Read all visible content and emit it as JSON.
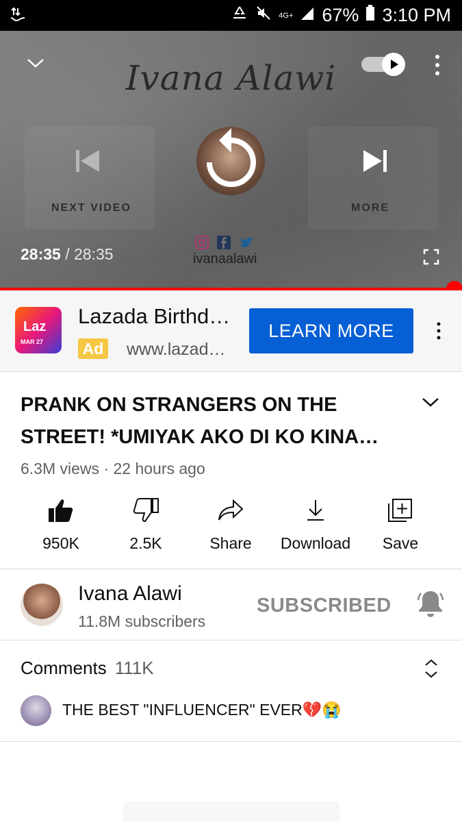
{
  "status_bar": {
    "network_label": "4G+",
    "battery": "67%",
    "time": "3:10 PM"
  },
  "player": {
    "channel_logo_text": "Ivana Alawi",
    "prev_label": "NEXT VIDEO",
    "next_label": "MORE",
    "current_time": "28:35",
    "separator": " / ",
    "duration": "28:35",
    "social_handle": "ivanaalawi",
    "progress_fraction": 1.0,
    "autoplay_on": true
  },
  "ad": {
    "title": "Lazada Birthd…",
    "badge": "Ad",
    "url": "www.lazad…",
    "cta": "LEARN MORE",
    "logo_text": "Laz",
    "logo_sub": "MAR 27"
  },
  "video": {
    "title": "PRANK ON STRANGERS ON THE STREET! *UMIYAK AKO DI KO KINA…",
    "meta": "6.3M views · 22 hours ago"
  },
  "actions": [
    {
      "label": "950K",
      "icon": "thumbs-up-filled"
    },
    {
      "label": "2.5K",
      "icon": "thumbs-down-outline"
    },
    {
      "label": "Share",
      "icon": "share-arrow"
    },
    {
      "label": "Download",
      "icon": "download-arrow"
    },
    {
      "label": "Save",
      "icon": "add-to-playlist"
    }
  ],
  "channel": {
    "name": "Ivana Alawi",
    "subscribers": "11.8M subscribers",
    "subscribe_state": "SUBSCRIBED"
  },
  "comments": {
    "label": "Comments",
    "count": "111K",
    "top_comment": "THE BEST \"INFLUENCER\" EVER💔😭"
  },
  "colors": {
    "accent_red": "#ff0000",
    "cta_blue": "#065fd4",
    "ad_badge": "#f6c745"
  }
}
